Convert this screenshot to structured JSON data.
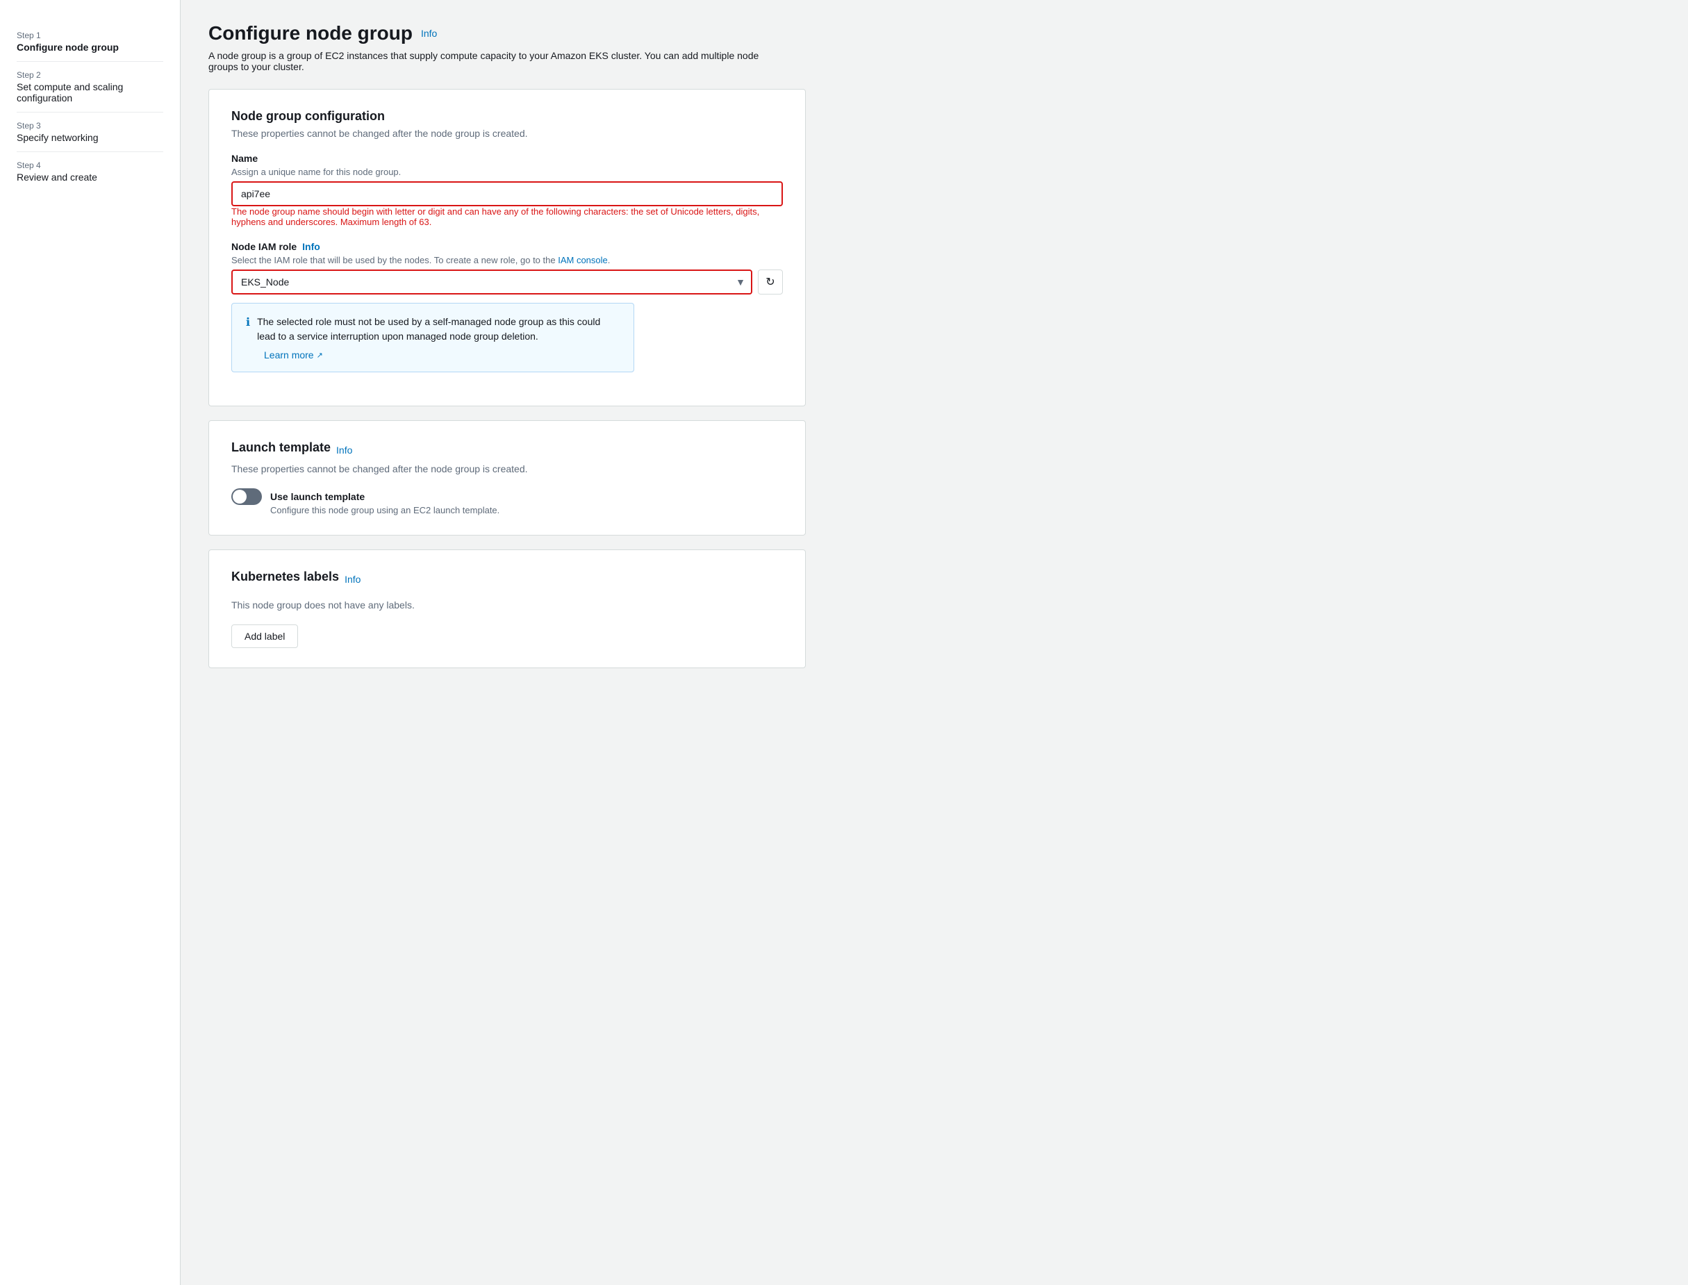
{
  "sidebar": {
    "steps": [
      {
        "id": "step1",
        "number": "Step 1",
        "label": "Configure node group",
        "active": true
      },
      {
        "id": "step2",
        "number": "Step 2",
        "label": "Set compute and scaling configuration",
        "active": false
      },
      {
        "id": "step3",
        "number": "Step 3",
        "label": "Specify networking",
        "active": false
      },
      {
        "id": "step4",
        "number": "Step 4",
        "label": "Review and create",
        "active": false
      }
    ]
  },
  "page": {
    "title": "Configure node group",
    "info_label": "Info",
    "description": "A node group is a group of EC2 instances that supply compute capacity to your Amazon EKS cluster. You can add multiple node groups to your cluster."
  },
  "node_group_config": {
    "card_title": "Node group configuration",
    "card_subtitle": "These properties cannot be changed after the node group is created.",
    "name_label": "Name",
    "name_description": "Assign a unique name for this node group.",
    "name_value": "api7ee",
    "name_validation": "The node group name should begin with letter or digit and can have any of the following characters: the set of Unicode letters, digits, hyphens and underscores. Maximum length of 63.",
    "iam_role_label": "Node IAM role",
    "iam_role_info": "Info",
    "iam_role_description_prefix": "Select the IAM role that will be used by the nodes. To create a new role, go to the",
    "iam_console_link_text": "IAM console",
    "iam_role_value": "EKS_Node",
    "info_box_text": "The selected role must not be used by a self-managed node group as this could lead to a service interruption upon managed node group deletion.",
    "learn_more_label": "Learn more"
  },
  "launch_template": {
    "card_title": "Launch template",
    "info_label": "Info",
    "card_subtitle": "These properties cannot be changed after the node group is created.",
    "toggle_label": "Use launch template",
    "toggle_description": "Configure this node group using an EC2 launch template.",
    "toggle_enabled": false
  },
  "kubernetes_labels": {
    "card_title": "Kubernetes labels",
    "info_label": "Info",
    "empty_text": "This node group does not have any labels.",
    "add_label_btn": "Add label"
  }
}
